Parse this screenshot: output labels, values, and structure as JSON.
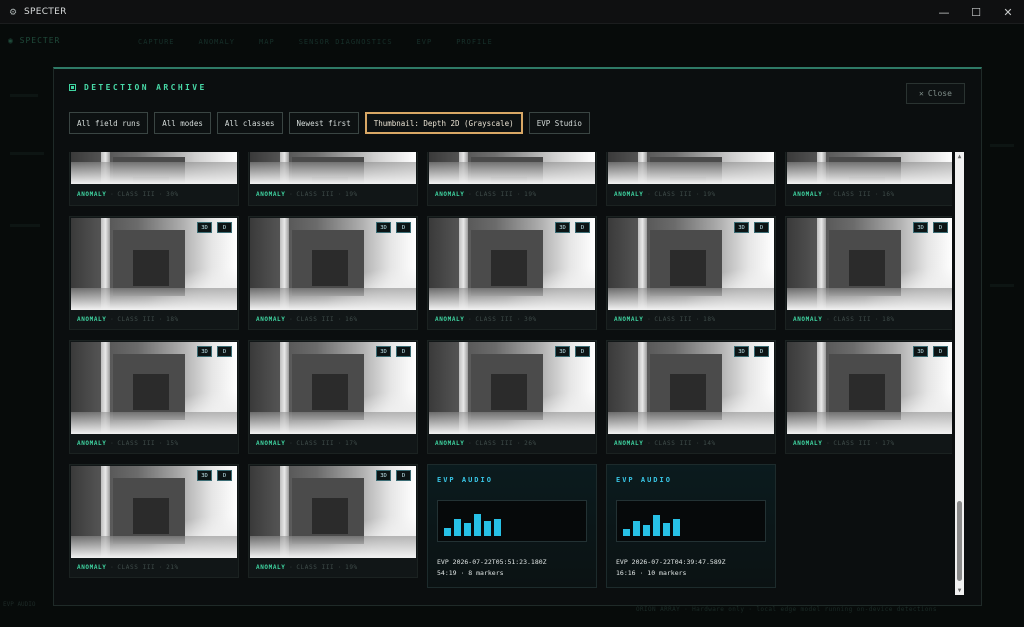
{
  "window": {
    "title": "SPECTER",
    "app_icon": "gear-icon",
    "minimize": "—",
    "maximize": "☐",
    "close": "✕"
  },
  "background": {
    "brand": "◉ SPECTER",
    "tabs": [
      "CAPTURE",
      "ANOMALY",
      "MAP",
      "SENSOR DIAGNOSTICS",
      "EVP",
      "PROFILE"
    ],
    "status": "ORION ARRAY · Hardware only · local edge model running on-device detections",
    "left_label": "EVP AUDIO"
  },
  "modal": {
    "title": "DETECTION ARCHIVE",
    "title_icon": "archive-icon",
    "close_label": "Close",
    "close_icon": "x-icon"
  },
  "filters": [
    {
      "label": "All field runs",
      "active": false
    },
    {
      "label": "All modes",
      "active": false
    },
    {
      "label": "All classes",
      "active": false
    },
    {
      "label": "Newest first",
      "active": false
    },
    {
      "label": "Thumbnail: Depth 2D (Grayscale)",
      "active": true
    },
    {
      "label": "EVP Studio",
      "active": false
    }
  ],
  "badges": {
    "three_d": "3D",
    "d": "D"
  },
  "caption_parts": {
    "sep": " · "
  },
  "partial_row": [
    {
      "kind": "ANOMALY",
      "cls": "CLASS III",
      "conf": "30%"
    },
    {
      "kind": "ANOMALY",
      "cls": "CLASS III",
      "conf": "19%"
    },
    {
      "kind": "ANOMALY",
      "cls": "CLASS III",
      "conf": "19%"
    },
    {
      "kind": "ANOMALY",
      "cls": "CLASS III",
      "conf": "19%"
    },
    {
      "kind": "ANOMALY",
      "cls": "CLASS III",
      "conf": "16%"
    }
  ],
  "row2": [
    {
      "kind": "ANOMALY",
      "cls": "CLASS III",
      "conf": "18%"
    },
    {
      "kind": "ANOMALY",
      "cls": "CLASS III",
      "conf": "16%"
    },
    {
      "kind": "ANOMALY",
      "cls": "CLASS III",
      "conf": "30%"
    },
    {
      "kind": "ANOMALY",
      "cls": "CLASS III",
      "conf": "18%"
    },
    {
      "kind": "ANOMALY",
      "cls": "CLASS III",
      "conf": "18%"
    }
  ],
  "row3": [
    {
      "kind": "ANOMALY",
      "cls": "CLASS III",
      "conf": "15%"
    },
    {
      "kind": "ANOMALY",
      "cls": "CLASS III",
      "conf": "17%"
    },
    {
      "kind": "ANOMALY",
      "cls": "CLASS III",
      "conf": "26%"
    },
    {
      "kind": "ANOMALY",
      "cls": "CLASS III",
      "conf": "14%"
    },
    {
      "kind": "ANOMALY",
      "cls": "CLASS III",
      "conf": "17%"
    }
  ],
  "row4": [
    {
      "kind": "ANOMALY",
      "cls": "CLASS III",
      "conf": "21%"
    },
    {
      "kind": "ANOMALY",
      "cls": "CLASS III",
      "conf": "19%"
    }
  ],
  "evp": [
    {
      "label": "EVP AUDIO",
      "id": "EVP 2026-07-22T05:51:23.180Z",
      "meta": "54:19 · 8 markers",
      "bars": [
        0.3,
        0.6,
        0.45,
        0.8,
        0.55,
        0.6
      ]
    },
    {
      "label": "EVP AUDIO",
      "id": "EVP 2026-07-22T04:39:47.589Z",
      "meta": "16:16 · 10 markers",
      "bars": [
        0.25,
        0.55,
        0.4,
        0.75,
        0.45,
        0.6
      ]
    }
  ],
  "scrollbar": {
    "up": "▲",
    "down": "▼"
  }
}
